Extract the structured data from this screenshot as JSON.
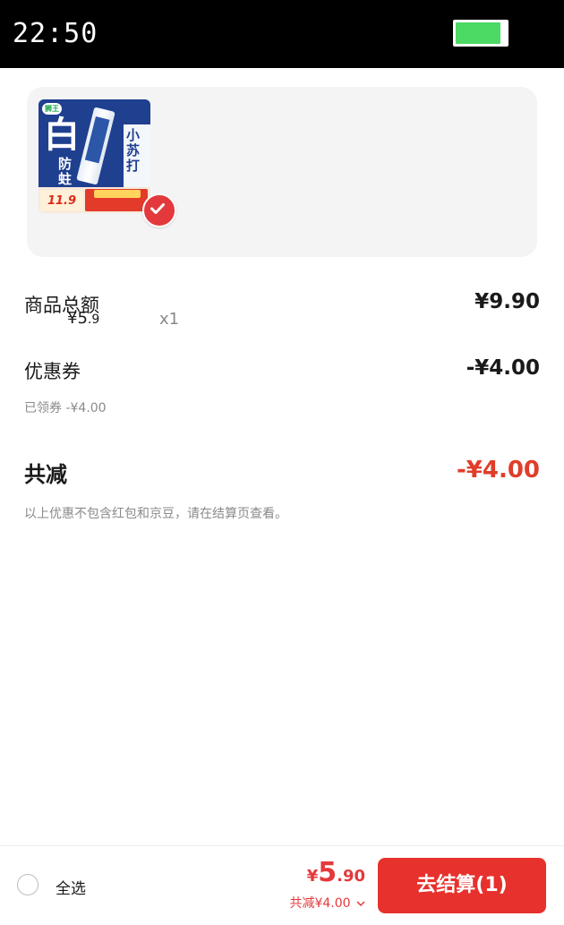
{
  "status_bar": {
    "time": "22:50",
    "battery_level": 0.9,
    "battery_color": "#4cd964"
  },
  "cart_item": {
    "image_text": {
      "brand": "狮王",
      "big_char": "白",
      "subtitle": "防蛀",
      "side_text": "小苏打",
      "price_tag": "11.9"
    },
    "price_symbol": "¥",
    "price_int": "5",
    "price_dec": ".9",
    "quantity": "x1",
    "selected": true
  },
  "summary": {
    "goods_total_label": "商品总额",
    "goods_total_value": "¥9.90",
    "coupon_label": "优惠券",
    "coupon_value": "-¥4.00",
    "coupon_note": "已领券 -¥4.00",
    "total_reduce_label": "共减",
    "total_reduce_value": "-¥4.00",
    "disclaimer": "以上优惠不包含红包和京豆，请在结算页查看。"
  },
  "bottom_bar": {
    "select_all_label": "全选",
    "price_symbol": "¥",
    "price_int": "5",
    "price_dec": ".90",
    "discount_text": "共减¥4.00",
    "checkout_label": "去结算(1)"
  },
  "colors": {
    "accent_red": "#e7312c",
    "price_red": "#e03d2a",
    "card_bg": "#f4f4f4"
  }
}
